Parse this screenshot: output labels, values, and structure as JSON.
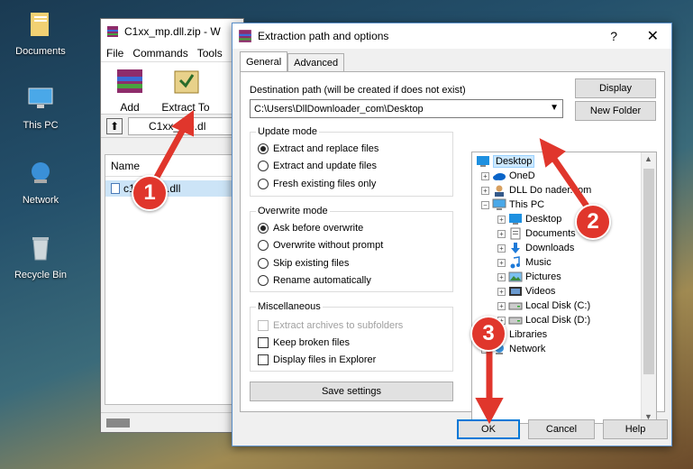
{
  "desktop": {
    "icons": [
      {
        "label": "Documents",
        "icon": "folder-icon"
      },
      {
        "label": "This PC",
        "icon": "computer-icon"
      },
      {
        "label": "Network",
        "icon": "network-icon"
      },
      {
        "label": "Recycle Bin",
        "icon": "recycle-bin-icon"
      }
    ]
  },
  "winrar": {
    "title": "C1xx_mp.dll.zip - W",
    "menu": [
      "File",
      "Commands",
      "Tools"
    ],
    "toolbar": [
      {
        "label": "Add",
        "icon": "add-archive-icon"
      },
      {
        "label": "Extract To",
        "icon": "extract-to-icon"
      }
    ],
    "path": "C1xx_mp.dl",
    "column_name": "Name",
    "file": "c1xx_mp.dll"
  },
  "dialog": {
    "title": "Extraction path and options",
    "help": "?",
    "close": "✕",
    "tabs": [
      "General",
      "Advanced"
    ],
    "dest_label": "Destination path (will be created if does not exist)",
    "dest_value": "C:\\Users\\DllDownloader_com\\Desktop",
    "display_button": "Display",
    "new_folder_button": "New Folder",
    "update_mode": {
      "title": "Update mode",
      "options": [
        "Extract and replace files",
        "Extract and update files",
        "Fresh existing files only"
      ],
      "selected": 0
    },
    "overwrite_mode": {
      "title": "Overwrite mode",
      "options": [
        "Ask before overwrite",
        "Overwrite without prompt",
        "Skip existing files",
        "Rename automatically"
      ],
      "selected": 0
    },
    "misc": {
      "title": "Miscellaneous",
      "options": [
        {
          "label": "Extract archives to subfolders",
          "disabled": true
        },
        {
          "label": "Keep broken files",
          "disabled": false
        },
        {
          "label": "Display files in Explorer",
          "disabled": false
        }
      ]
    },
    "save_settings": "Save settings",
    "tree": [
      {
        "label": "Desktop",
        "icon": "desktop-icon",
        "selected": true
      },
      {
        "label": "OneD",
        "icon": "onedrive-icon"
      },
      {
        "label": "DLL Do    nader.com",
        "icon": "user-icon"
      },
      {
        "label": "This PC",
        "icon": "computer-icon"
      },
      {
        "label": "Desktop",
        "icon": "desktop-icon"
      },
      {
        "label": "Documents",
        "icon": "documents-icon"
      },
      {
        "label": "Downloads",
        "icon": "downloads-icon"
      },
      {
        "label": "Music",
        "icon": "music-icon"
      },
      {
        "label": "Pictures",
        "icon": "pictures-icon"
      },
      {
        "label": "Videos",
        "icon": "videos-icon"
      },
      {
        "label": "Local Disk (C:)",
        "icon": "drive-icon"
      },
      {
        "label": "Local Disk (D:)",
        "icon": "drive-icon"
      },
      {
        "label": "Libraries",
        "icon": "libraries-icon"
      },
      {
        "label": "Network",
        "icon": "network-icon"
      }
    ],
    "ok": "OK",
    "cancel": "Cancel",
    "help_button": "Help"
  },
  "markers": [
    "1",
    "2",
    "3"
  ],
  "colors": {
    "marker": "#e0362c",
    "selection": "#cce8ff",
    "accent": "#0078d7"
  }
}
